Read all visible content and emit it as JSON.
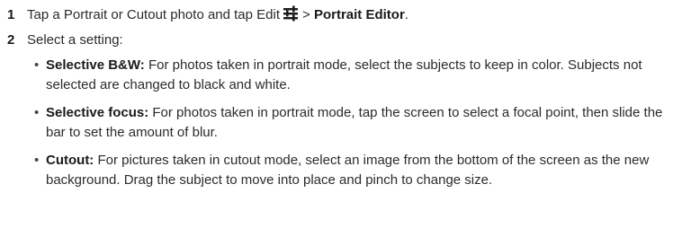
{
  "steps": [
    {
      "number": "1",
      "text_before": "Tap a Portrait or Cutout photo and tap Edit",
      "icon": "edit-sliders-icon",
      "separator": ">",
      "bold_target": "Portrait Editor",
      "text_after": "."
    },
    {
      "number": "2",
      "text": "Select a setting:"
    }
  ],
  "options": [
    {
      "title": "Selective B&W:",
      "description": "For photos taken in portrait mode, select the subjects to keep in color. Subjects not selected are changed to black and white."
    },
    {
      "title": "Selective focus:",
      "description": "For photos taken in portrait mode, tap the screen to select a focal point, then slide the bar to set the amount of blur."
    },
    {
      "title": "Cutout:",
      "description": "For pictures taken in cutout mode, select an image from the bottom of the screen as the new background. Drag the subject to move into place and pinch to change size."
    }
  ],
  "bullet_symbol": "•"
}
